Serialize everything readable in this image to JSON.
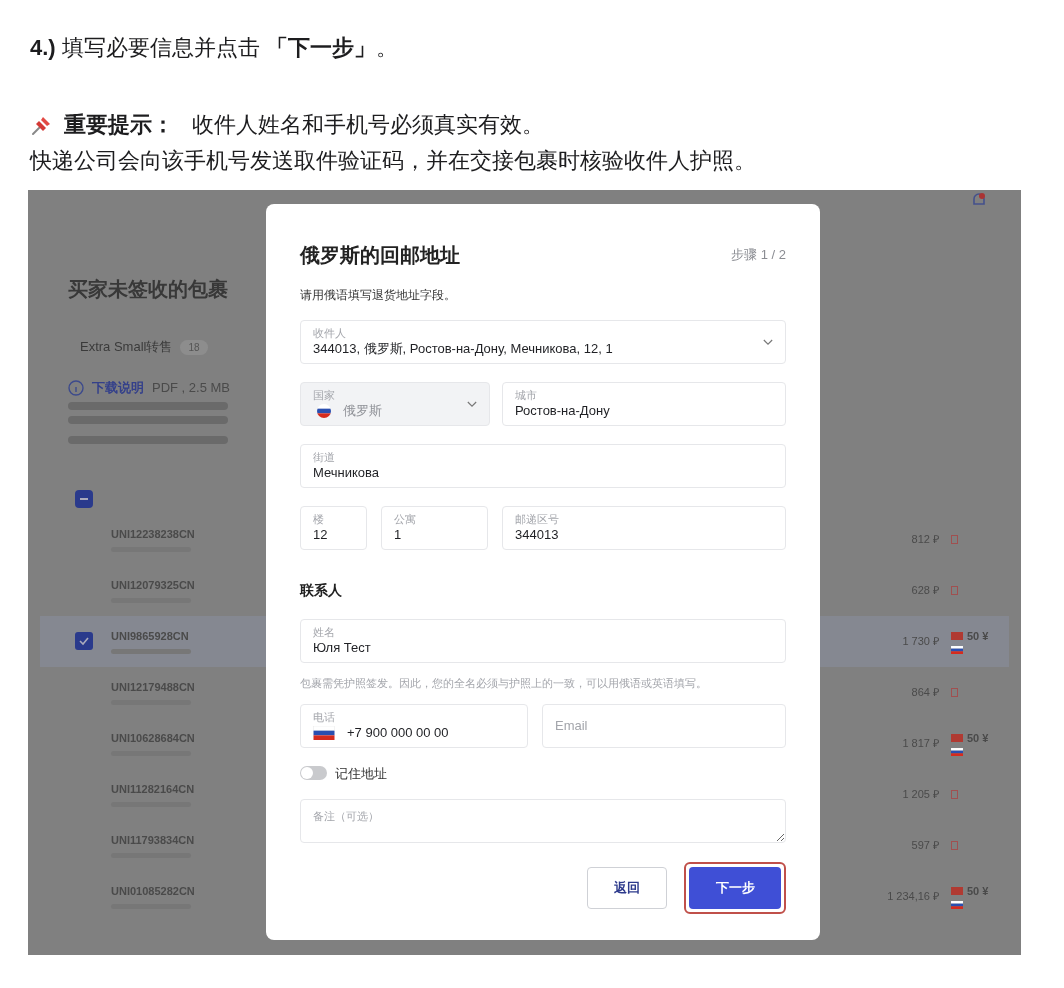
{
  "step_line": "**4.)** 填写必要信息并点击 **「下一步」**。",
  "note": {
    "label": "重要提示：",
    "text": "收件人姓名和手机号必须真实有效。",
    "line2": "快递公司会向该手机号发送取件验证码，并在交接包裹时核验收件人护照。"
  },
  "background": {
    "title": "买家未签收的包裹",
    "tabs": [
      {
        "label": "Extra Small转售",
        "count": "18",
        "selected": false
      }
    ],
    "download": {
      "link": "下载说明",
      "meta": "PDF , 2.5 MB"
    },
    "header_checkbox": {
      "indeterminate": true
    },
    "rows": [
      {
        "tracking": "UNI12238238CN",
        "price": "812 ₽",
        "selected": false,
        "kind": "plain"
      },
      {
        "tracking": "UNI12079325CN",
        "price": "628 ₽",
        "selected": false,
        "kind": "plain"
      },
      {
        "tracking": "UNI9865928CN",
        "price": "1 730 ₽",
        "selected": true,
        "kind": "fee",
        "fee": "50 ¥"
      },
      {
        "tracking": "UNI12179488CN",
        "price": "864 ₽",
        "selected": false,
        "kind": "plain"
      },
      {
        "tracking": "UNI10628684CN",
        "price": "1 817 ₽",
        "selected": false,
        "kind": "fee",
        "fee": "50 ¥"
      },
      {
        "tracking": "UNI11282164CN",
        "price": "1 205 ₽",
        "selected": false,
        "kind": "plain"
      },
      {
        "tracking": "UNI11793834CN",
        "price": "597 ₽",
        "selected": false,
        "kind": "plain"
      },
      {
        "tracking": "UNI01085282CN",
        "price": "1 234,16 ₽",
        "selected": false,
        "kind": "fee",
        "fee": "50 ¥"
      }
    ]
  },
  "dialog": {
    "title": "俄罗斯的回邮地址",
    "step": "步骤 1 / 2",
    "subtitle": "请用俄语填写退货地址字段。",
    "recipient": {
      "label": "收件人",
      "value": "344013, 俄罗斯, Ростов-на-Дону, Мечникова, 12, 1"
    },
    "country": {
      "label": "国家",
      "value": "俄罗斯",
      "disabled": true
    },
    "city": {
      "label": "城市",
      "value": "Ростов-на-Дону"
    },
    "street": {
      "label": "街道",
      "value": "Мечникова"
    },
    "building": {
      "label": "楼",
      "value": "12"
    },
    "apartment": {
      "label": "公寓",
      "value": "1"
    },
    "postcode": {
      "label": "邮递区号",
      "value": "344013"
    },
    "contact_heading": "联系人",
    "name": {
      "label": "姓名",
      "value": "Юля Тест"
    },
    "name_hint": "包裹需凭护照签发。因此，您的全名必须与护照上的一致，可以用俄语或英语填写。",
    "phone": {
      "label": "电话",
      "value": "+7 900 000 00 00"
    },
    "email": {
      "placeholder": "Email"
    },
    "remember": {
      "label": "记住地址",
      "on": false
    },
    "comment": {
      "placeholder": "备注（可选）"
    },
    "buttons": [
      {
        "label": "返回",
        "kind": "secondary",
        "highlighted": false
      },
      {
        "label": "下一步",
        "kind": "primary",
        "highlighted": true
      }
    ]
  }
}
